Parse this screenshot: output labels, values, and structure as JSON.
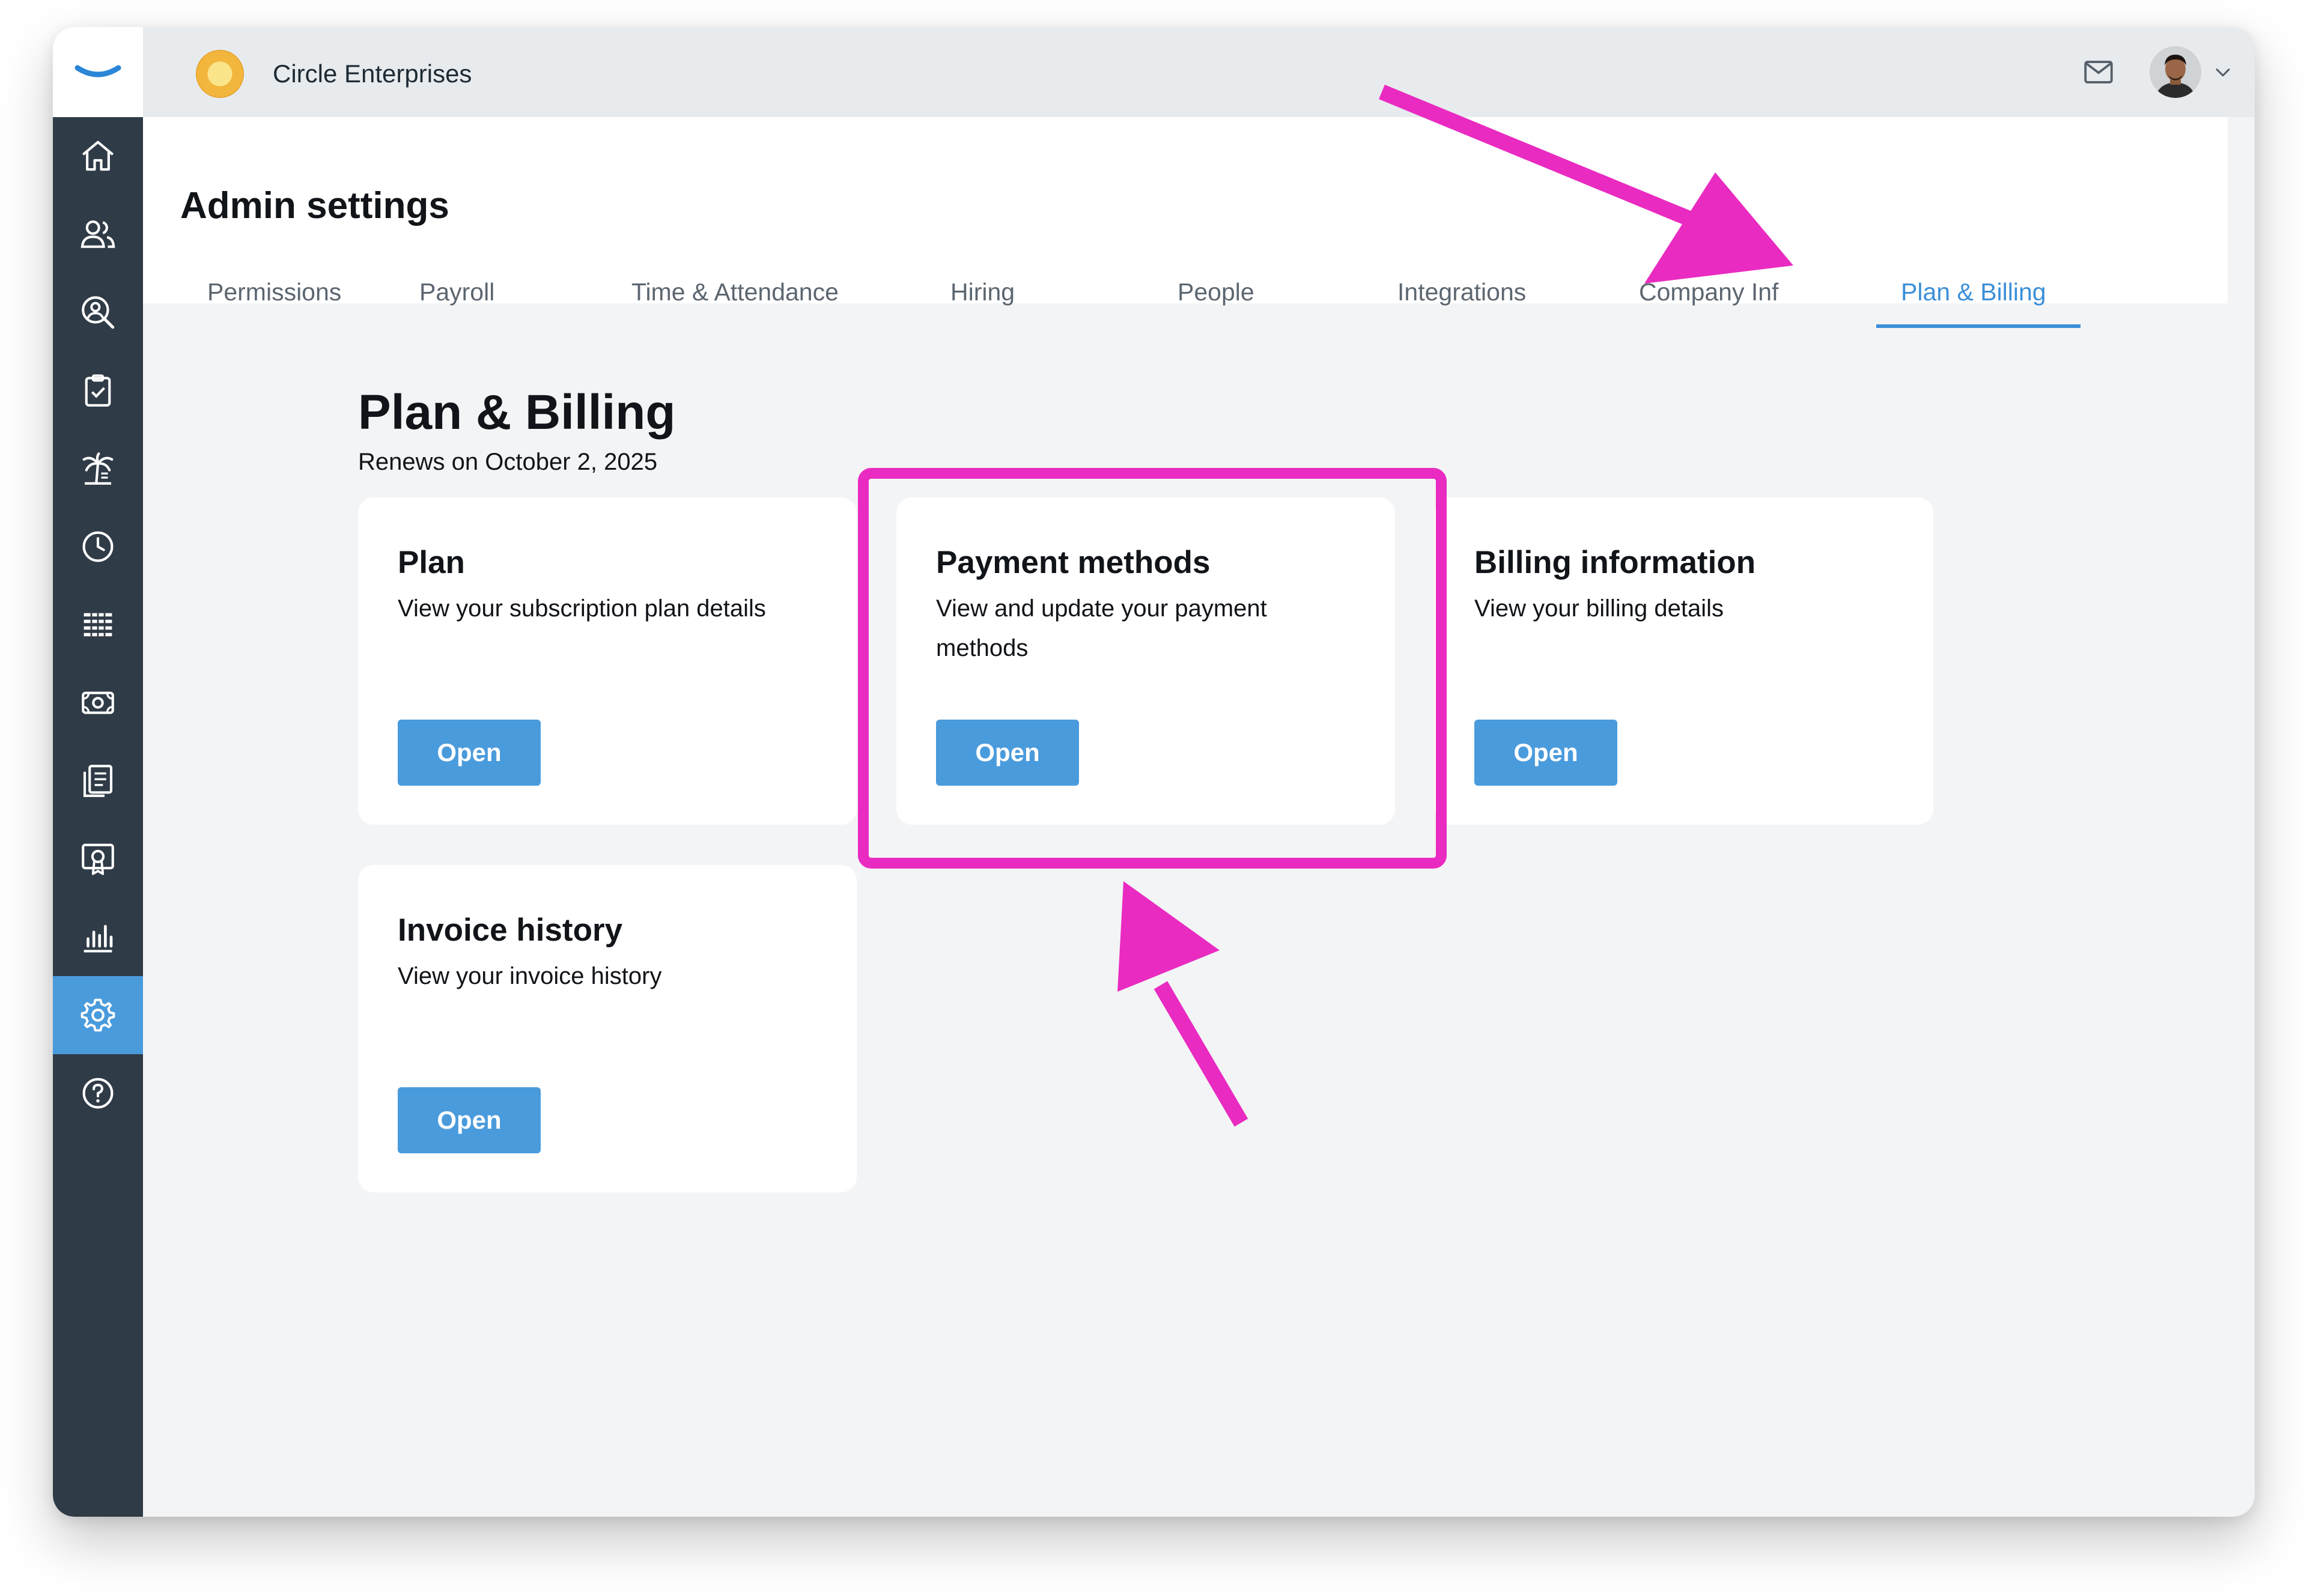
{
  "topbar": {
    "company_name": "Circle Enterprises"
  },
  "sidebar": {
    "items": [
      {
        "icon": "home-icon"
      },
      {
        "icon": "people-icon"
      },
      {
        "icon": "search-person-icon"
      },
      {
        "icon": "clipboard-check-icon"
      },
      {
        "icon": "palm-tree-icon"
      },
      {
        "icon": "clock-icon"
      },
      {
        "icon": "table-icon"
      },
      {
        "icon": "money-icon"
      },
      {
        "icon": "documents-icon"
      },
      {
        "icon": "certificate-icon"
      },
      {
        "icon": "bar-chart-icon"
      },
      {
        "icon": "gear-icon",
        "active": true
      },
      {
        "icon": "help-icon"
      }
    ]
  },
  "header": {
    "title": "Admin settings",
    "tabs": [
      {
        "label": "Permissions"
      },
      {
        "label": "Payroll"
      },
      {
        "label": "Time & Attendance"
      },
      {
        "label": "Hiring"
      },
      {
        "label": "People"
      },
      {
        "label": "Integrations"
      },
      {
        "label": "Company Inf"
      },
      {
        "label": "Plan & Billing",
        "active": true
      }
    ]
  },
  "main": {
    "title": "Plan & Billing",
    "subtitle": "Renews on October 2, 2025",
    "cards": [
      {
        "title": "Plan",
        "description": "View your subscription plan details",
        "button": "Open"
      },
      {
        "title": "Payment methods",
        "description": "View and update your payment methods",
        "button": "Open"
      },
      {
        "title": "Billing information",
        "description": "View your billing details",
        "button": "Open"
      },
      {
        "title": "Invoice history",
        "description": "View your invoice history",
        "button": "Open"
      }
    ]
  },
  "colors": {
    "accent": "#4a9bdc",
    "active_tab": "#3b8fd8",
    "sidebar": "#2f3b47",
    "annotation": "#e92bc1"
  }
}
